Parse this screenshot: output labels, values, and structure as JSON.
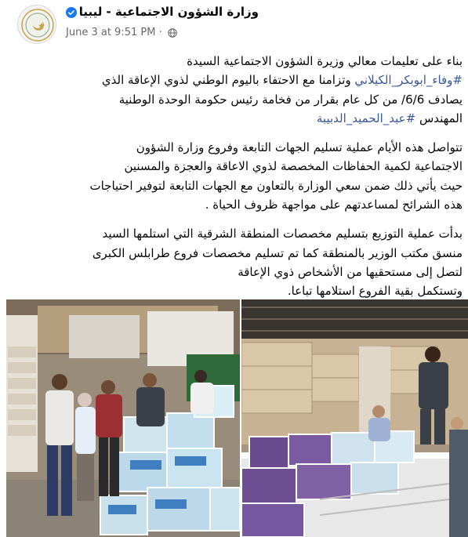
{
  "post": {
    "page_name": "وزارة الشؤون الاجتماعية - ليبيا",
    "verified": true,
    "timestamp": "June 3 at 9:51 PM",
    "separator": "·",
    "privacy_icon": "globe-icon",
    "text": {
      "p1": {
        "l1": "بناء على تعليمات معالي  وزيرة الشؤون الاجتماعية السيدة",
        "l2_tag": "#وفاء_ابوبكر_الكيلاني",
        "l2_text": " وتزامنا مع الاحتفاء باليوم الوطني لذوي الإعاقة الذي",
        "l3": "يصادف 6/6/ من كل عام بقرار من فخامة رئيس حكومة الوحدة الوطنية",
        "l4_text": "المهندس ",
        "l4_tag": "#عبد_الحميد_الدبيبة"
      },
      "p2": {
        "l1": "تتواصل هذه الأيام عملية  تسليم الجهات التابعة وفروع وزارة الشؤون",
        "l2": "الاجتماعية  لكمية الحفاظات المخصصة لذوي الاعاقة  والعجزة والمسنين",
        "l3": "حيث يأتي ذلك ضمن سعي الوزارة بالتعاون مع الجهات التابعة لتوفير احتياجات",
        "l4": "هذه الشرائح لمساعدتهم على مواجهة ظروف الحياة ."
      },
      "p3": {
        "l1": "بدأت عملية التوزيع بتسليم مخصصات المنطقة الشرقية التي استلمها السيد",
        "l2": "منسق مكتب الوزير بالمنطقة كما تم تسليم مخصصات فروع طرابلس الكبرى",
        "l3": "لتصل إلى مستحقيها من الأشخاص ذوي الإعاقة",
        "l4": "وتستكمل بقية الفروع استلامها تباعا."
      }
    },
    "photos": [
      "photo-warehouse-group",
      "photo-truck-loading"
    ],
    "colors": {
      "hashtag": "#385898",
      "verified": "#1877f2",
      "meta": "#65676b"
    }
  }
}
